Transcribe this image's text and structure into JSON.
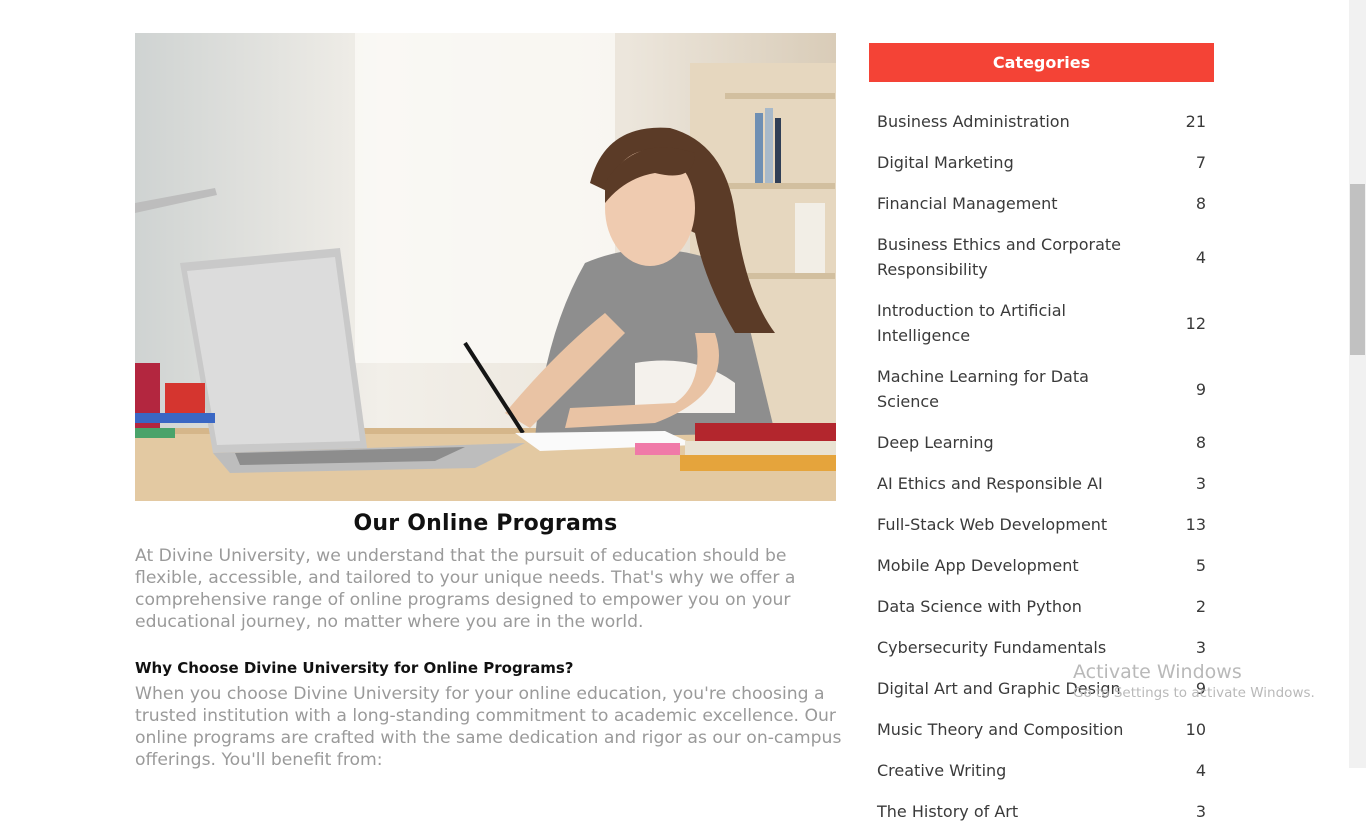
{
  "main": {
    "hero_alt": "Student studying with laptop",
    "title": "Our Online Programs",
    "intro": "At Divine University, we understand that the pursuit of education should be flexible, accessible, and tailored to your unique needs. That's why we offer a comprehensive range of online programs designed to empower you on your educational journey, no matter where you are in the world.",
    "subheading": "Why Choose Divine University for Online Programs?",
    "body": "When you choose Divine University for your online education, you're choosing a trusted institution with a long-standing commitment to academic excellence. Our online programs are crafted with the same dedication and rigor as our on-campus offerings. You'll benefit from:"
  },
  "sidebar": {
    "header": "Categories",
    "accent_color": "#f44336",
    "categories": [
      {
        "name": "Business Administration",
        "count": "21"
      },
      {
        "name": "Digital Marketing",
        "count": "7"
      },
      {
        "name": "Financial Management",
        "count": "8"
      },
      {
        "name": "Business Ethics and Corporate Responsibility",
        "count": "4"
      },
      {
        "name": "Introduction to Artificial Intelligence",
        "count": "12"
      },
      {
        "name": "Machine Learning for Data Science",
        "count": "9"
      },
      {
        "name": "Deep Learning",
        "count": "8"
      },
      {
        "name": "AI Ethics and Responsible AI",
        "count": "3"
      },
      {
        "name": "Full-Stack Web Development",
        "count": "13"
      },
      {
        "name": "Mobile App Development",
        "count": "5"
      },
      {
        "name": "Data Science with Python",
        "count": "2"
      },
      {
        "name": "Cybersecurity Fundamentals",
        "count": "3"
      },
      {
        "name": "Digital Art and Graphic Design",
        "count": "9"
      },
      {
        "name": "Music Theory and Composition",
        "count": "10"
      },
      {
        "name": "Creative Writing",
        "count": "4"
      },
      {
        "name": "The History of Art",
        "count": "3"
      }
    ]
  },
  "watermark": {
    "line1": "Activate Windows",
    "line2": "Go to Settings to activate Windows."
  }
}
